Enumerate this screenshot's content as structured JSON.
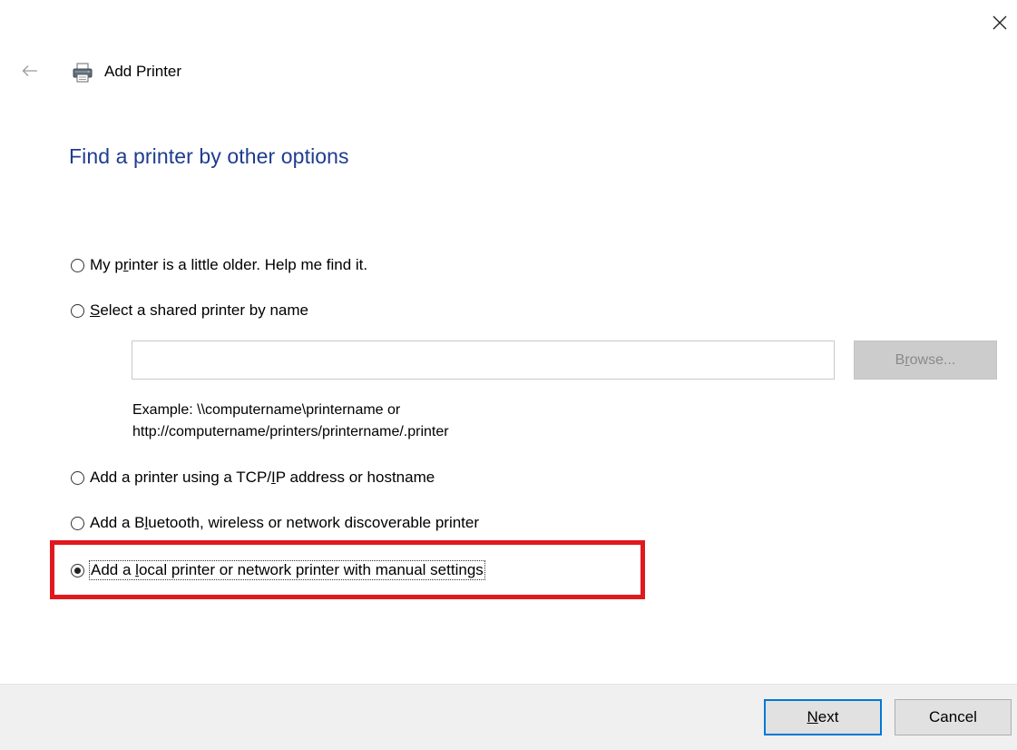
{
  "window": {
    "title": "Add Printer",
    "close_icon": "close-icon",
    "back_icon": "back-arrow-icon",
    "app_icon": "printer-icon"
  },
  "heading": "Find a printer by other options",
  "options": [
    {
      "pre": "My p",
      "key": "r",
      "post": "inter is a little older. Help me find it.",
      "checked": false
    },
    {
      "pre": "",
      "key": "S",
      "post": "elect a shared printer by name",
      "checked": false
    },
    {
      "pre": "Add a printer using a TCP/",
      "key": "I",
      "post": "P address or hostname",
      "checked": false
    },
    {
      "pre": "Add a B",
      "key": "l",
      "post": "uetooth, wireless or network discoverable printer",
      "checked": false
    },
    {
      "pre": "Add a ",
      "key": "l",
      "post": "ocal printer or network printer with manual settings",
      "checked": true
    }
  ],
  "shared_printer": {
    "input_value": "",
    "browse_pre": "B",
    "browse_key": "r",
    "browse_post": "owse...",
    "example_line1": "Example: \\\\computername\\printername or",
    "example_line2": "http://computername/printers/printername/.printer"
  },
  "footer": {
    "next_key": "N",
    "next_post": "ext",
    "cancel_label": "Cancel"
  },
  "colors": {
    "heading": "#1e3d8f",
    "highlight": "#e0191f",
    "focus_border": "#0078d7"
  }
}
